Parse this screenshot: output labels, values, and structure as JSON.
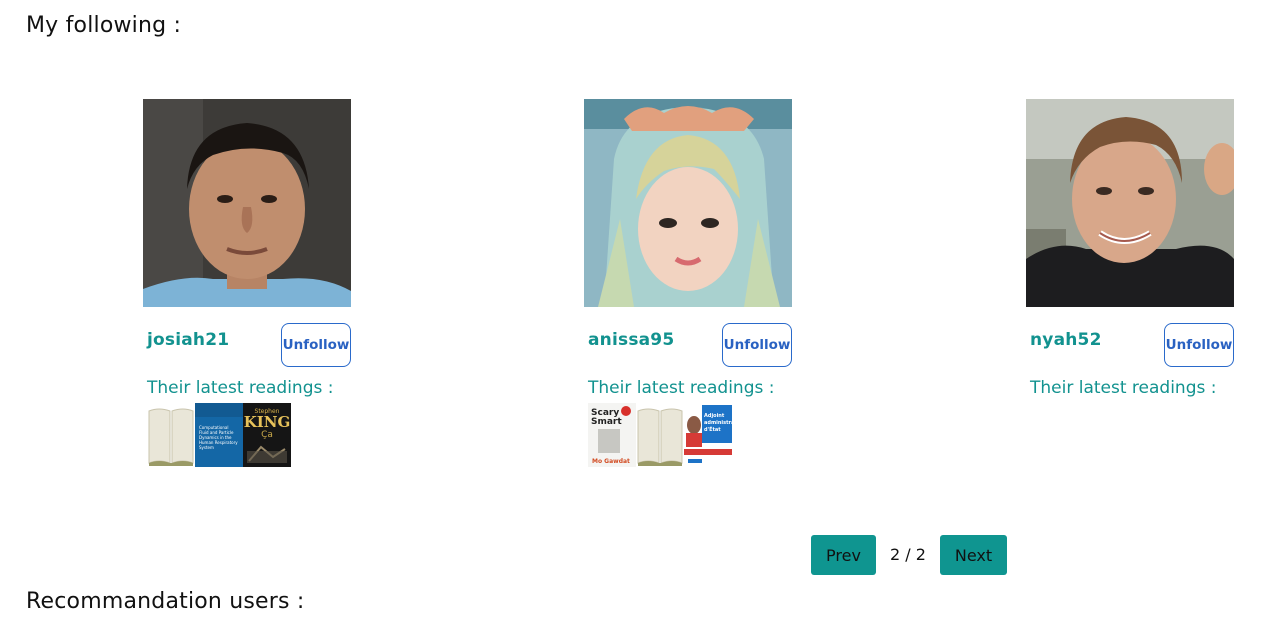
{
  "following_title": "My following :",
  "recommend_title": "Recommandation users :",
  "users": [
    {
      "username": "josiah21",
      "unfollow_label": "Unfollow",
      "readings_label": "Their latest readings :",
      "books": [
        {
          "icon": "open-book-placeholder-icon"
        },
        {
          "cover_text": "Computational Fluid and Particle Dynamics in the Human Respiratory System"
        },
        {
          "cover_text": "Stephen KING Ça"
        }
      ]
    },
    {
      "username": "anissa95",
      "unfollow_label": "Unfollow",
      "readings_label": "Their latest readings :",
      "books": [
        {
          "cover_text": "Scary Smart Mo Gawdat"
        },
        {
          "icon": "open-book-placeholder-icon"
        },
        {
          "cover_text": "Adjoint administratif d'État"
        }
      ]
    },
    {
      "username": "nyah52",
      "unfollow_label": "Unfollow",
      "readings_label": "Their latest readings :",
      "books": []
    }
  ],
  "pagination": {
    "prev_label": "Prev",
    "page_indicator": "2 / 2",
    "next_label": "Next"
  },
  "colors": {
    "accent": "#12928f",
    "button_teal": "#0f9590",
    "unfollow_blue": "#2a62c2"
  }
}
